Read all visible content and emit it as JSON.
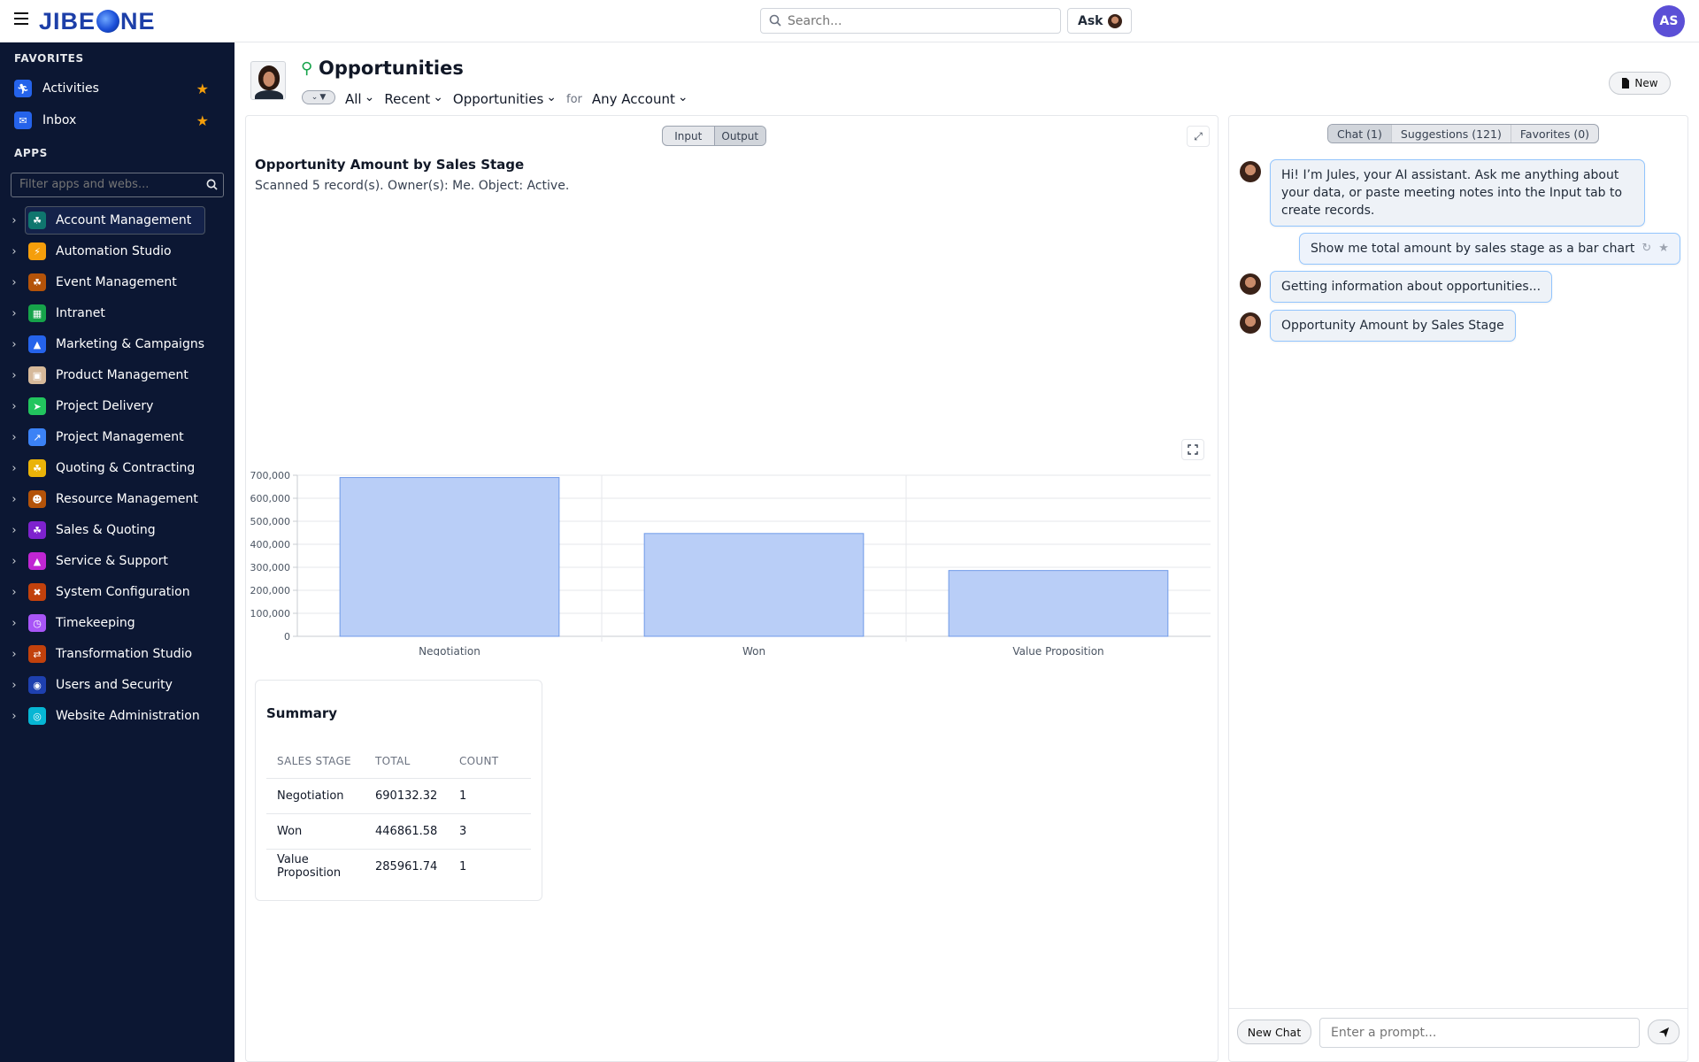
{
  "header": {
    "logo": [
      "JIBE",
      "NE"
    ],
    "search_placeholder": "Search...",
    "ask_label": "Ask",
    "user_initials": "AS"
  },
  "sidebar": {
    "favorites_title": "FAVORITES",
    "favorites": [
      {
        "label": "Activities",
        "icon": "running-person-icon",
        "color": "#2563eb"
      },
      {
        "label": "Inbox",
        "icon": "envelope-icon",
        "color": "#2563eb"
      }
    ],
    "apps_title": "APPS",
    "filter_placeholder": "Filter apps and webs...",
    "apps": [
      {
        "label": "Account Management",
        "icon": "hand-coin-icon",
        "color": "#0f766e",
        "active": true
      },
      {
        "label": "Automation Studio",
        "icon": "bolt-icon",
        "color": "#f59e0b"
      },
      {
        "label": "Event Management",
        "icon": "hand-coin-icon",
        "color": "#b45309"
      },
      {
        "label": "Intranet",
        "icon": "sitemap-icon",
        "color": "#16a34a"
      },
      {
        "label": "Marketing & Campaigns",
        "icon": "megaphone-icon",
        "color": "#2563eb"
      },
      {
        "label": "Product Management",
        "icon": "box-icon",
        "color": "#d6b99a"
      },
      {
        "label": "Project Delivery",
        "icon": "rocket-icon",
        "color": "#22c55e"
      },
      {
        "label": "Project Management",
        "icon": "chart-line-icon",
        "color": "#3b82f6"
      },
      {
        "label": "Quoting & Contracting",
        "icon": "hand-coin-icon",
        "color": "#eab308"
      },
      {
        "label": "Resource Management",
        "icon": "user-gear-icon",
        "color": "#b45309"
      },
      {
        "label": "Sales & Quoting",
        "icon": "hand-coin-icon",
        "color": "#7e22ce"
      },
      {
        "label": "Service & Support",
        "icon": "bell-icon",
        "color": "#c026d3"
      },
      {
        "label": "System Configuration",
        "icon": "tools-icon",
        "color": "#c2410c"
      },
      {
        "label": "Timekeeping",
        "icon": "clock-icon",
        "color": "#a855f7"
      },
      {
        "label": "Transformation Studio",
        "icon": "arrows-swap-icon",
        "color": "#c2410c"
      },
      {
        "label": "Users and Security",
        "icon": "shield-icon",
        "color": "#1e40af"
      },
      {
        "label": "Website Administration",
        "icon": "globe-icon",
        "color": "#06b6d4"
      }
    ]
  },
  "page": {
    "title": "Opportunities",
    "filters": {
      "scope": "All",
      "recency": "Recent",
      "object": "Opportunities",
      "for_label": "for",
      "account": "Any Account"
    },
    "new_label": "New"
  },
  "output": {
    "toggle": [
      "Input",
      "Output"
    ],
    "active_tab": "Output",
    "title": "Opportunity Amount by Sales Stage",
    "subtitle": "Scanned 5 record(s). Owner(s): Me. Object: Active."
  },
  "chart_data": {
    "type": "bar",
    "categories": [
      "Negotiation",
      "Won",
      "Value Proposition"
    ],
    "values": [
      690132.32,
      446861.58,
      285961.74
    ],
    "ylim": [
      0,
      700000
    ],
    "yticks": [
      "0",
      "100,000",
      "200,000",
      "300,000",
      "400,000",
      "500,000",
      "600,000",
      "700,000"
    ],
    "bar_color": "#b9cef7",
    "bar_border": "#6f9ae8",
    "grid": true,
    "xlabel": "",
    "ylabel": ""
  },
  "summary": {
    "title": "Summary",
    "columns": [
      "SALES STAGE",
      "TOTAL",
      "COUNT"
    ],
    "rows": [
      [
        "Negotiation",
        "690132.32",
        "1"
      ],
      [
        "Won",
        "446861.58",
        "3"
      ],
      [
        "Value Proposition",
        "285961.74",
        "1"
      ]
    ]
  },
  "chat": {
    "tabs": [
      "Chat (1)",
      "Suggestions (121)",
      "Favorites (0)"
    ],
    "messages": [
      {
        "role": "assistant",
        "text": "Hi! I’m Jules, your AI assistant. Ask me anything about your data, or paste meeting notes into the Input tab to create records."
      },
      {
        "role": "user",
        "text": "Show me total amount by sales stage as a bar chart"
      },
      {
        "role": "assistant",
        "text": "Getting information about opportunities..."
      },
      {
        "role": "assistant",
        "text": "Opportunity Amount by Sales Stage"
      }
    ],
    "new_chat_label": "New Chat",
    "prompt_placeholder": "Enter a prompt..."
  }
}
